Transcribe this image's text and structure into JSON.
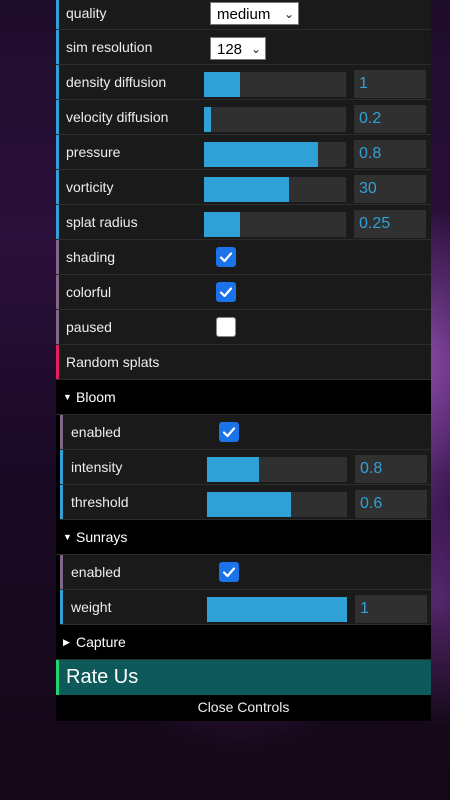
{
  "controls": {
    "quality": {
      "label": "quality",
      "value": "medium"
    },
    "sim_resolution": {
      "label": "sim resolution",
      "value": "128"
    },
    "density_diffusion": {
      "label": "density diffusion",
      "value": "1",
      "fill_fraction": 0.25
    },
    "velocity_diffusion": {
      "label": "velocity diffusion",
      "value": "0.2",
      "fill_fraction": 0.05
    },
    "pressure": {
      "label": "pressure",
      "value": "0.8",
      "fill_fraction": 0.8
    },
    "vorticity": {
      "label": "vorticity",
      "value": "30",
      "fill_fraction": 0.6
    },
    "splat_radius": {
      "label": "splat radius",
      "value": "0.25",
      "fill_fraction": 0.25
    },
    "shading": {
      "label": "shading",
      "checked": true
    },
    "colorful": {
      "label": "colorful",
      "checked": true
    },
    "paused": {
      "label": "paused",
      "checked": false
    },
    "random_splats": {
      "label": "Random splats"
    }
  },
  "bloom": {
    "folder_label": "Bloom",
    "enabled": {
      "label": "enabled",
      "checked": true
    },
    "intensity": {
      "label": "intensity",
      "value": "0.8",
      "fill_fraction": 0.37
    },
    "threshold": {
      "label": "threshold",
      "value": "0.6",
      "fill_fraction": 0.6
    }
  },
  "sunrays": {
    "folder_label": "Sunrays",
    "enabled": {
      "label": "enabled",
      "checked": true
    },
    "weight": {
      "label": "weight",
      "value": "1",
      "fill_fraction": 1.0
    }
  },
  "capture": {
    "folder_label": "Capture"
  },
  "rate_us": {
    "label": "Rate Us"
  },
  "close_controls": {
    "label": "Close Controls"
  },
  "colors": {
    "accent": "#2fa1d6",
    "checkbox": "#1a73e8",
    "number_bar": "#2fa1d6",
    "boolean_bar": "#806787",
    "function_bar": "#e61d5f",
    "rate_bg": "#0e5a5a",
    "rate_bar": "#1fd66e"
  },
  "icons": {
    "folder_open": "triangle-down-icon",
    "folder_closed": "triangle-right-icon",
    "check": "checkmark-icon",
    "dropdown": "chevron-down-icon"
  }
}
